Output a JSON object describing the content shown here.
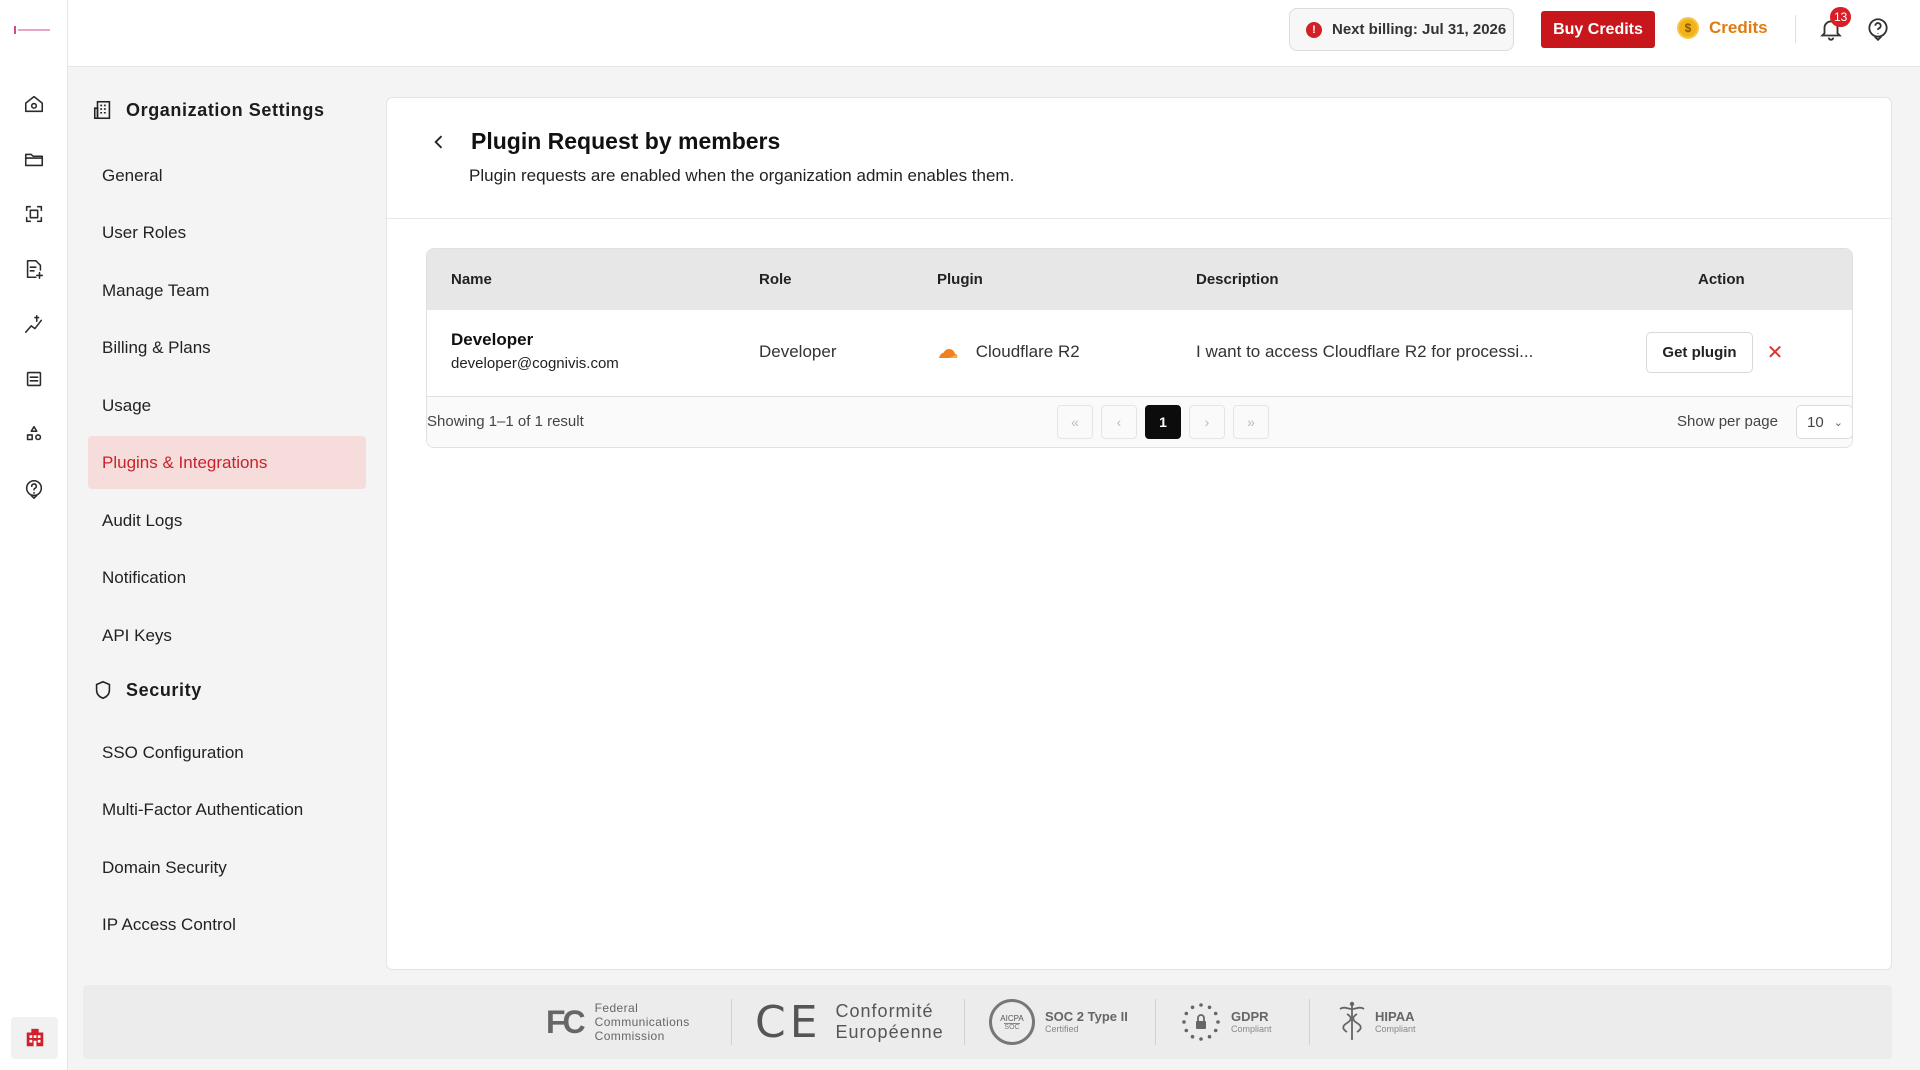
{
  "rail": {
    "icons": [
      "home-icon",
      "folder-icon",
      "scan-icon",
      "document-add-icon",
      "cost-chart-icon",
      "grid-list-icon",
      "shapes-icon",
      "help-circle-icon"
    ],
    "org_icon": "building-icon"
  },
  "topbar": {
    "billing_text": "Next billing: Jul 31, 2026",
    "buy_label": "Buy Credits",
    "credits_label": "Credits",
    "notification_count": "13",
    "accent_color": "#c8161d"
  },
  "nav": {
    "org_heading": "Organization Settings",
    "org_items": [
      {
        "label": "General"
      },
      {
        "label": "User Roles"
      },
      {
        "label": "Manage Team"
      },
      {
        "label": "Billing & Plans"
      },
      {
        "label": "Usage"
      },
      {
        "label": "Plugins & Integrations",
        "active": true
      },
      {
        "label": "Audit Logs"
      },
      {
        "label": "Notification"
      },
      {
        "label": "API Keys"
      }
    ],
    "security_heading": "Security",
    "security_items": [
      {
        "label": "SSO Configuration"
      },
      {
        "label": "Multi-Factor Authentication"
      },
      {
        "label": "Domain Security"
      },
      {
        "label": "IP Access Control"
      }
    ]
  },
  "page": {
    "title": "Plugin Request by members",
    "subtitle": "Plugin requests are enabled when the organization admin enables them."
  },
  "table": {
    "columns": [
      "Name",
      "Role",
      "Plugin",
      "Description",
      "Action"
    ],
    "rows": [
      {
        "name": "Developer",
        "email": "developer@cognivis.com",
        "role": "Developer",
        "plugin": "Cloudflare R2",
        "description": "I want to access Cloudflare R2 for processi...",
        "action_label": "Get plugin"
      }
    ],
    "showing": "Showing 1–1 of 1 result",
    "pager": {
      "first": "«",
      "prev": "‹",
      "current": "1",
      "next": "›",
      "last": "»"
    },
    "per_page_label": "Show per page",
    "per_page_value": "10"
  },
  "compliance": {
    "fcc": {
      "mark": "FC",
      "lines": [
        "Federal",
        "Communications",
        "Commission"
      ]
    },
    "ce": {
      "mark": "CE",
      "lines": [
        "Conformité",
        "Européenne"
      ]
    },
    "soc": {
      "mark_top": "AICPA",
      "mark_bottom": "SOC",
      "title": "SOC 2 Type II",
      "sub": "Certified"
    },
    "gdpr": {
      "title": "GDPR",
      "sub": "Compliant"
    },
    "hipaa": {
      "title": "HIPAA",
      "sub": "Compliant"
    }
  }
}
